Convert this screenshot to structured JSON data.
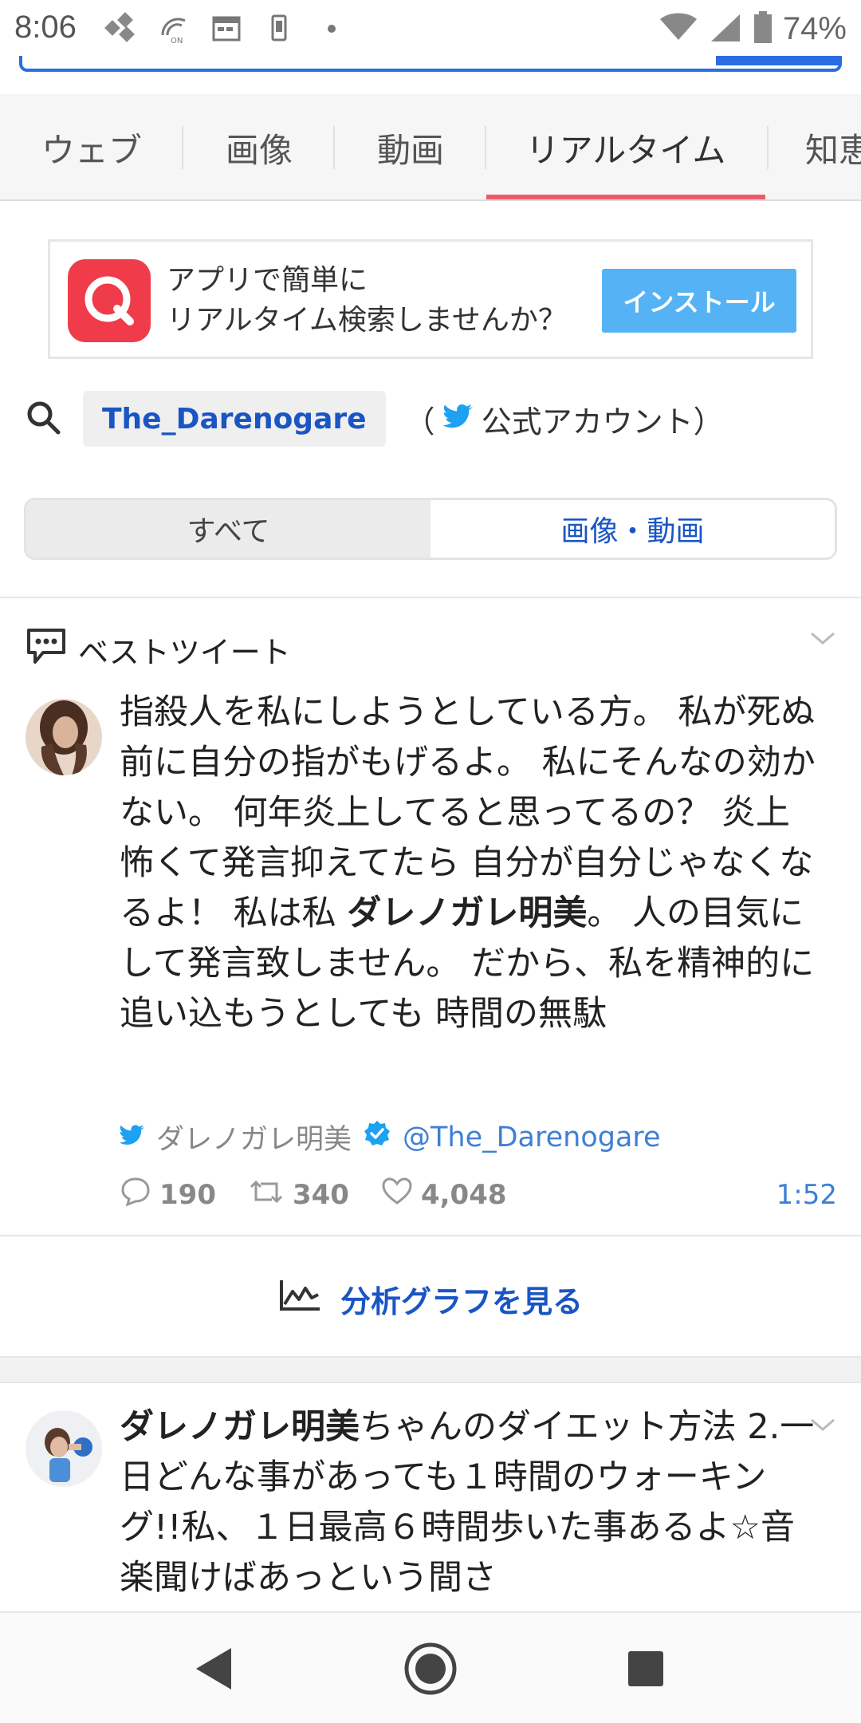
{
  "status_bar": {
    "time": "8:06",
    "battery": "74%"
  },
  "progress": {
    "fraction": 0.15
  },
  "tabs": [
    {
      "label": "ウェブ",
      "active": false
    },
    {
      "label": "画像",
      "active": false
    },
    {
      "label": "動画",
      "active": false
    },
    {
      "label": "リアルタイム",
      "active": true
    },
    {
      "label": "知恵",
      "active": false
    }
  ],
  "banner": {
    "line1": "アプリで簡単に",
    "line2": "リアルタイム検索しませんか？",
    "install_label": "インストール"
  },
  "query": {
    "chip": "The_Darenogare",
    "paren_open": "（",
    "official": "公式アカウント）"
  },
  "segment": {
    "all_label": "すべて",
    "media_label": "画像・動画"
  },
  "best_tweet": {
    "header": "ベストツイート",
    "body_before": "指殺人を私にしようとしている方。 私が死ぬ前に自分の指がもげるよ。 私にそんなの効かない。 何年炎上してると思ってるの？ 炎上怖くて発言抑えてたら 自分が自分じゃなくなるよ！ 私は私 ",
    "body_bold": "ダレノガレ明美",
    "body_after": "。 人の目気にして発言致しません。 だから、私を精神的に追い込もうとしても 時間の無駄",
    "author_name": "ダレノガレ明美",
    "author_handle": "@The_Darenogare",
    "replies": "190",
    "retweets": "340",
    "likes": "4,048",
    "time": "1:52"
  },
  "graph_link": "分析グラフを見る",
  "tweet2": {
    "bold": "ダレノガレ明美",
    "text": "ちゃんのダイエット方法 2.一日どんな事があっても１時間のウォーキング!!私、１日最高６時間歩いた事あるよ☆音楽聞けばあっという間さ"
  },
  "colors": {
    "accent_blue": "#1a55c4",
    "tab_underline": "#f0596a",
    "install": "#55b3f5",
    "app_icon": "#f03c4a",
    "twitter": "#1da1f2"
  }
}
